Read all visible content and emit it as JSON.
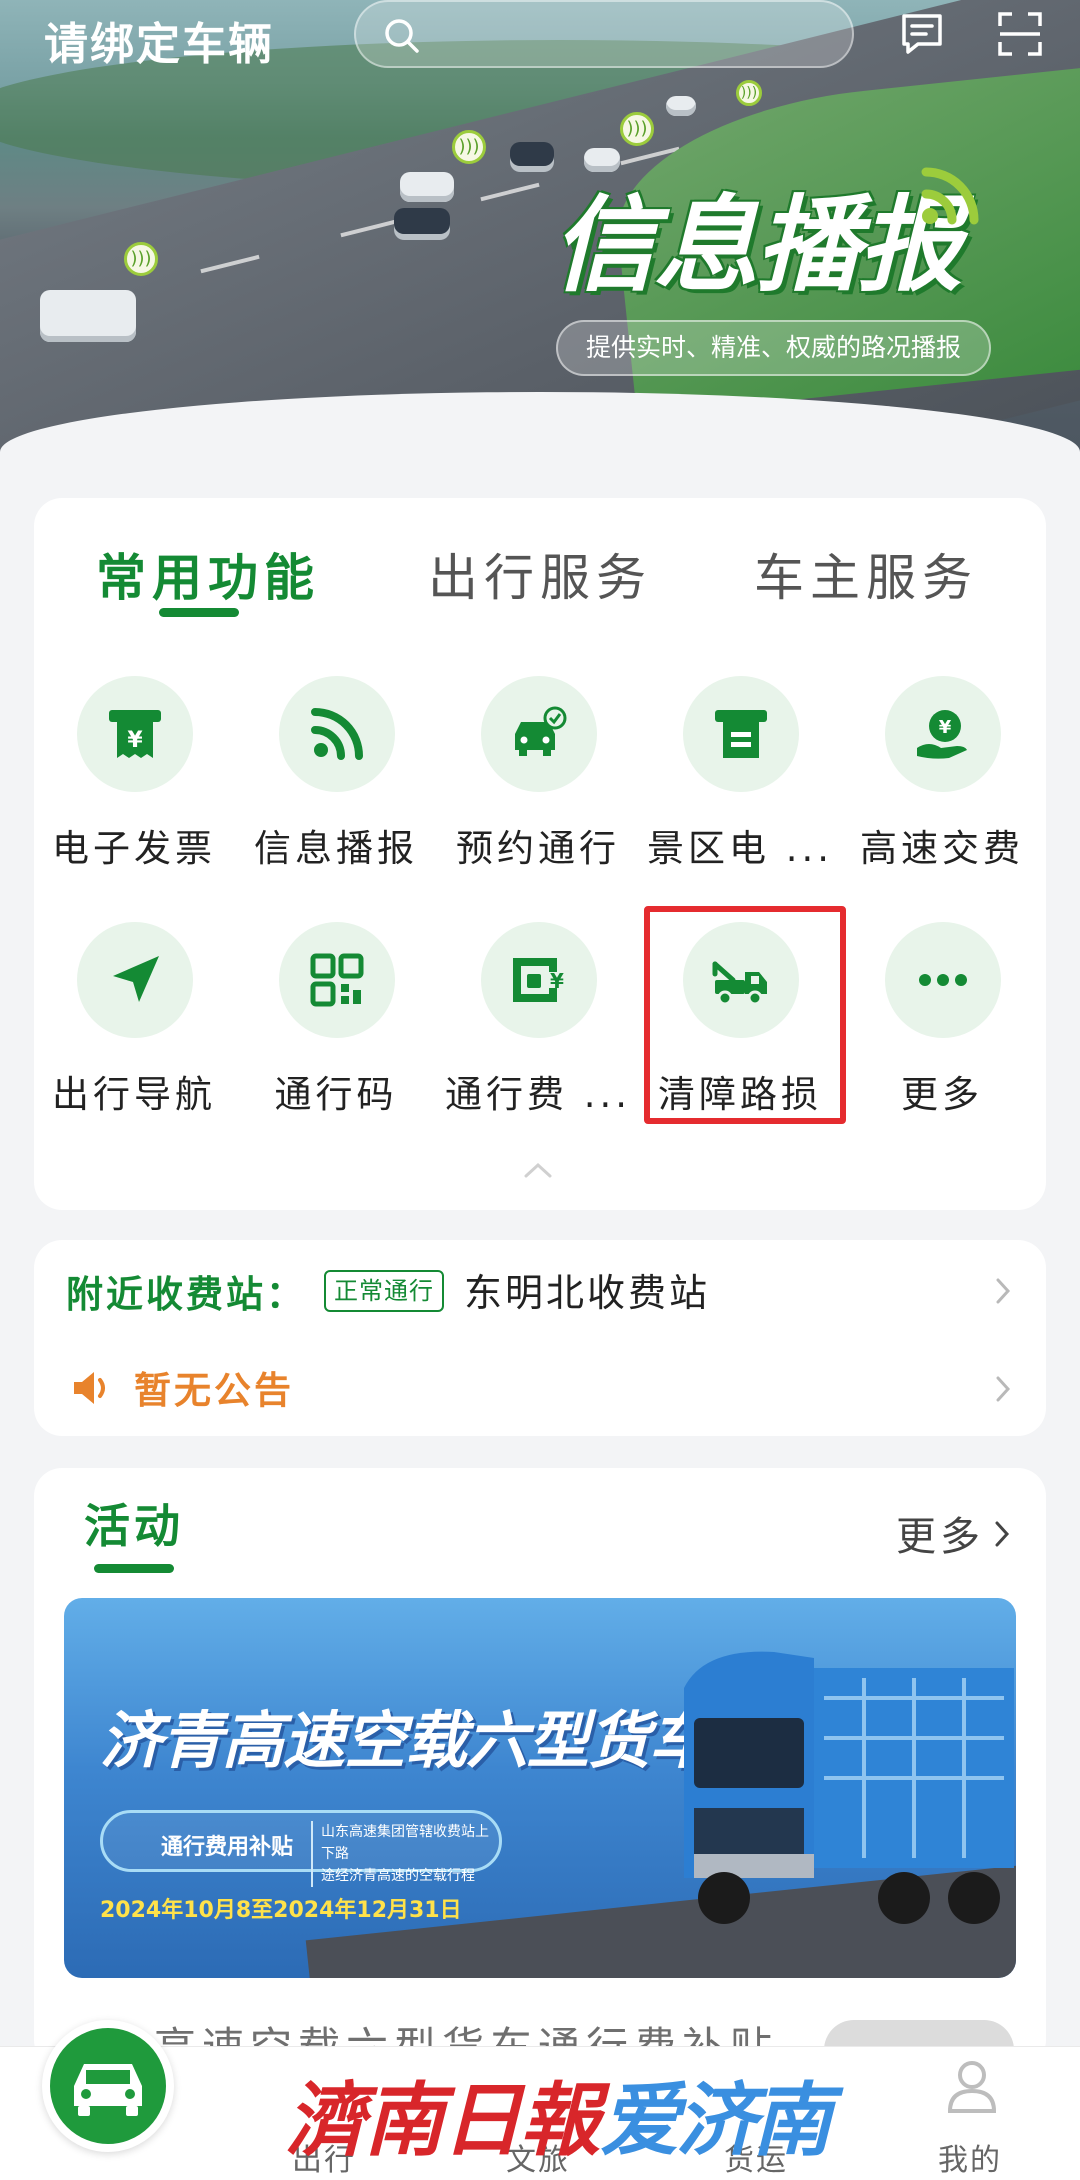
{
  "header": {
    "bind_vehicle": "请绑定车辆",
    "search_icon": "search-icon",
    "message_icon": "message-icon",
    "scan_icon": "scan-icon"
  },
  "banner": {
    "title": "信息播报",
    "subtitle": "提供实时、精准、权威的路况播报",
    "page_count": 3,
    "active_page": 3
  },
  "function_tabs": [
    {
      "label": "常用功能",
      "active": true
    },
    {
      "label": "出行服务",
      "active": false
    },
    {
      "label": "车主服务",
      "active": false
    }
  ],
  "functions": [
    {
      "label": "电子发票",
      "icon": "invoice-icon"
    },
    {
      "label": "信息播报",
      "icon": "broadcast-icon"
    },
    {
      "label": "预约通行",
      "icon": "car-reserve-icon"
    },
    {
      "label": "景区电 ...",
      "icon": "scenic-icon"
    },
    {
      "label": "高速交费",
      "icon": "payment-icon"
    },
    {
      "label": "出行导航",
      "icon": "navigation-icon"
    },
    {
      "label": "通行码",
      "icon": "qr-code-icon"
    },
    {
      "label": "通行费 ...",
      "icon": "toll-fee-icon"
    },
    {
      "label": "清障路损",
      "icon": "tow-truck-icon",
      "highlighted": true
    },
    {
      "label": "更多",
      "icon": "more-icon"
    }
  ],
  "nearby": {
    "label": "附近收费站：",
    "status": "正常通行",
    "station": "东明北收费站"
  },
  "notice": {
    "text": "暂无公告"
  },
  "activity": {
    "title": "活动",
    "more": "更多",
    "promo": {
      "title": "济青高速空载六型货车",
      "pill_main": "通行费用补贴",
      "pill_sub_1": "山东高速集团管辖收费站上下路",
      "pill_sub_2": "途经济青高速的空载行程",
      "date": "2024年10月8至2024年12月31日"
    },
    "peek_text": "高速空载六型货车通行费补贴"
  },
  "bottom_nav": [
    {
      "label": "出行",
      "icon": "car-icon"
    },
    {
      "label": "文旅",
      "icon": "travel-icon"
    },
    {
      "label": "货运",
      "icon": "freight-icon"
    },
    {
      "label": "我的",
      "icon": "user-icon"
    }
  ],
  "watermark": {
    "left": "濟南日報",
    "right": "爱济南"
  },
  "colors": {
    "primary": "#148a34",
    "notice": "#e8832c",
    "highlight": "#e52b2f"
  }
}
